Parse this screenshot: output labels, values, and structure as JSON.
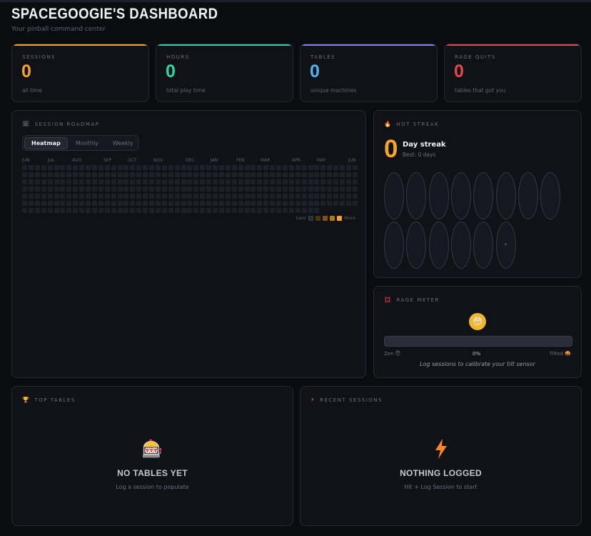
{
  "header": {
    "title": "SPACEGOOGIE'S DASHBOARD",
    "subtitle": "Your pinball command center"
  },
  "stats": [
    {
      "label": "SESSIONS",
      "value": "0",
      "sub": "all time",
      "color": "#f5a524"
    },
    {
      "label": "HOURS",
      "value": "0",
      "sub": "total play time",
      "color": "#2dd4a7"
    },
    {
      "label": "TABLES",
      "value": "0",
      "sub": "unique machines",
      "color": "#4fb3f0"
    },
    {
      "label": "RAGE QUITS",
      "value": "0",
      "sub": "tables that got you",
      "color": "#e5484d"
    }
  ],
  "roadmap": {
    "title": "SESSION ROADMAP",
    "icon": "calendar-icon",
    "tabs": [
      "Heatmap",
      "Monthly",
      "Weekly"
    ],
    "active_tab": "Heatmap",
    "months": [
      "JUN",
      "JUL",
      "AUG",
      "SEP",
      "OCT",
      "NOV",
      "DEC",
      "JAN",
      "FEB",
      "MAR",
      "APR",
      "MAY",
      "JUN"
    ],
    "legend_less": "Less",
    "legend_more": "More",
    "legend_colors": [
      "#1e2029",
      "#4a3610",
      "#7a5512",
      "#b07a16",
      "#f5a524"
    ]
  },
  "streak": {
    "title": "HOT STREAK",
    "icon": "flame-icon",
    "value": "0",
    "label": "Day streak",
    "best": "Best: 0 days",
    "star": "*"
  },
  "rage": {
    "title": "RAGE METER",
    "icon": "anger-icon",
    "face": "😳",
    "percent": 0,
    "percent_label": "0%",
    "zen": "Zen 😇",
    "tilted": "Tilted 🤬",
    "note": "Log sessions to calibrate your tilt sensor"
  },
  "top_tables": {
    "title": "TOP TABLES",
    "icon": "trophy-icon",
    "empty_icon": "🎰",
    "empty_title": "NO TABLES YET",
    "empty_sub": "Log a session to populate"
  },
  "recent": {
    "title": "RECENT SESSIONS",
    "icon": "bolt-icon",
    "empty_title": "NOTHING LOGGED",
    "empty_sub": "Hit + Log Session to start"
  }
}
